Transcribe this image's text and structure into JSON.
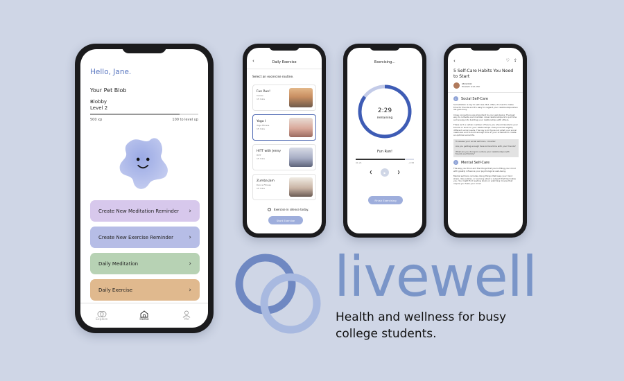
{
  "colors": {
    "background": "#cfd6e6",
    "accent": "#5b78c0",
    "meditation": "#d7c8ec",
    "exercise_reminder": "#b6bde6",
    "daily_meditation": "#b7d2b4",
    "daily_exercise": "#e0b98e"
  },
  "home": {
    "greeting": "Hello, Jane.",
    "pet_section_title": "Your Pet Blob",
    "pet_name": "Blobby",
    "pet_level": "Level 2",
    "xp_current": "500 xp",
    "xp_to_level": "100 to level up",
    "xp_progress": 0.83,
    "buttons": [
      {
        "label": "Create New Meditation Reminder"
      },
      {
        "label": "Create New Exercise Reminder"
      },
      {
        "label": "Daily Meditation"
      },
      {
        "label": "Daily Exercise"
      }
    ],
    "tabs": [
      {
        "label": "Explore",
        "icon": "explore-icon"
      },
      {
        "label": "Home",
        "icon": "home-icon"
      },
      {
        "label": "Me",
        "icon": "person-icon"
      }
    ]
  },
  "daily_exercise": {
    "title": "Daily Exercise",
    "subtitle": "Select an excercise routine.",
    "routines": [
      {
        "name": "Fun Run!",
        "type": "Cardio",
        "duration": "15 mins"
      },
      {
        "name": "Yoga I",
        "type": "Yoga Fitness",
        "duration": "15 mins"
      },
      {
        "name": "HITT with Jenny",
        "type": "HITT",
        "duration": "15 mins"
      },
      {
        "name": "Zumba Jam",
        "type": "Dance Fitness",
        "duration": "15 mins"
      }
    ],
    "silence_option": "Exercise in silence today.",
    "start_label": "Start Exercise"
  },
  "exercising": {
    "title": "Exercising...",
    "time_remaining": "2:29",
    "remaining_label": "remaining",
    "track_name": "Fun Run!",
    "elapsed": "01:21",
    "total": "-2:38",
    "progress": 0.85,
    "finish_label": "Finish Exercising"
  },
  "article": {
    "title": "5 Self-Care Habits You Need to Start",
    "date": "08/04/2022",
    "author": "Elizabeth Scott, PhD",
    "section1_num": "1",
    "section1_title": "Social Self-Care",
    "p1": "Socialization is key to self-care. But, often, it's hard to make time for friends and it's easy to neglect your relationships when life gets busy.",
    "p2": "Close connections are important to your well-being. The best way to cultivate and maintain close relationships is to put time and energy into building your relationships with others.",
    "p3": "There isn't a certain number of hours you should devote to your friends or work on your relationships. Everyone has slightly different social needs. The key is to figure out what your social needs are and to build enough time in your schedule to create an optimal social life.",
    "box_intro": "To assess your social self-care, consider:",
    "box_q1": "Are you getting enough face-to-face time with your friends?",
    "box_q2": "What are you doing to nurture your relationships with friends and family?",
    "section2_num": "2",
    "section2_title": "Mental Self-Care",
    "p4": "The way you think and the things that you're filling your mind with greatly influence your psychological well-being.",
    "p5": "Mental self-care includes doing things that keep your mind sharp, like puzzles, or learning about a subject that fascinates you. You might find reading books or watching movies that inspire you fuels your mind."
  },
  "brand": {
    "name": "livewell",
    "tagline": "Health and wellness for busy college students."
  }
}
